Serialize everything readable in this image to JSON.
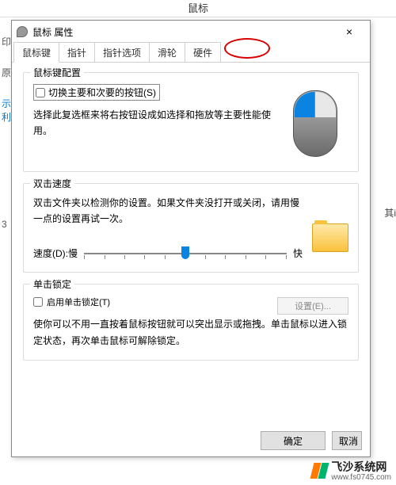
{
  "bg": {
    "header": "鼠标",
    "side": {
      "a": "印",
      "b": "原",
      "c": "示利",
      "d": "3"
    },
    "right": "其i"
  },
  "dialog": {
    "title": "鼠标 属性",
    "tabs": [
      "鼠标键",
      "指针",
      "指针选项",
      "滑轮",
      "硬件"
    ],
    "group1": {
      "legend": "鼠标键配置",
      "checkbox": "切换主要和次要的按钮(S)",
      "desc": "选择此复选框来将右按钮设成如选择和拖放等主要性能使用。"
    },
    "group2": {
      "legend": "双击速度",
      "desc": "双击文件夹以检测你的设置。如果文件夹没打开或关闭，请用慢一点的设置再试一次。",
      "speed_label": "速度(D):",
      "slow": "慢",
      "fast": "快"
    },
    "group3": {
      "legend": "单击锁定",
      "checkbox": "启用单击锁定(T)",
      "settings_btn": "设置(E)...",
      "desc": "使你可以不用一直按着鼠标按钮就可以突出显示或拖拽。单击鼠标以进入锁定状态，再次单击鼠标可解除锁定。"
    },
    "buttons": {
      "ok": "确定",
      "cancel": "取消"
    }
  },
  "watermark": {
    "title": "飞沙系统网",
    "url": "www.fs0745.com"
  }
}
